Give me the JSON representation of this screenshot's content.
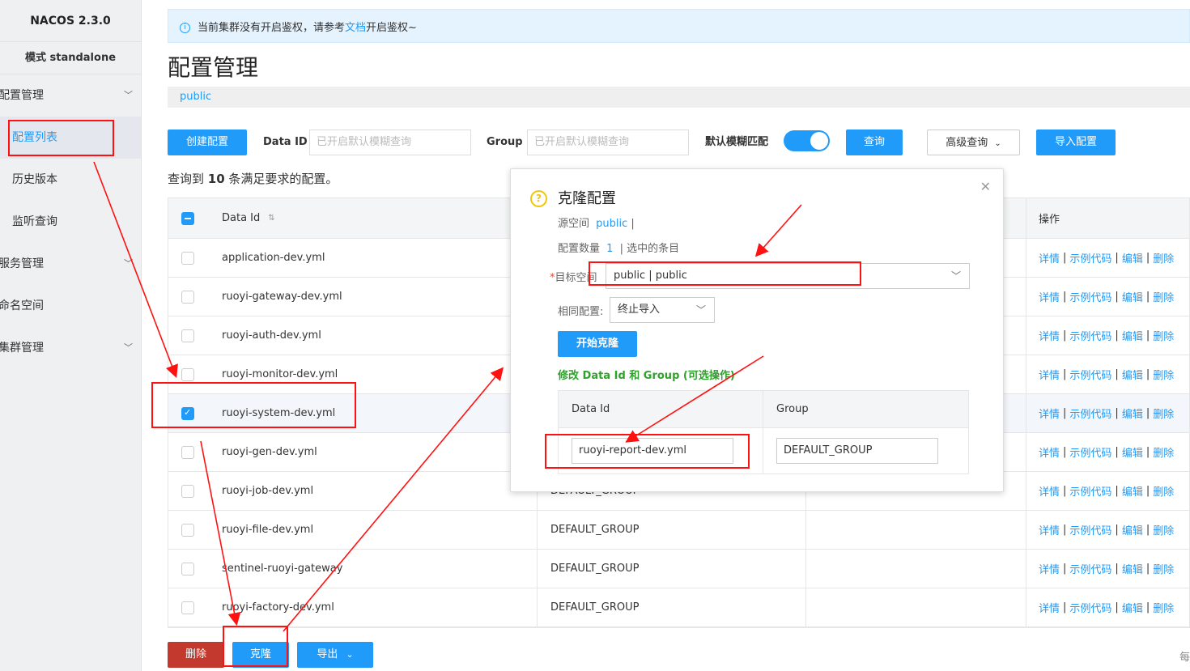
{
  "sidebar": {
    "brand": "NACOS 2.3.0",
    "mode": "模式 standalone",
    "groups": [
      {
        "label": "配置管理"
      },
      {
        "label": "服务管理"
      },
      {
        "label": "命名空间"
      },
      {
        "label": "集群管理"
      }
    ],
    "items": [
      {
        "label": "配置列表"
      },
      {
        "label": "历史版本"
      },
      {
        "label": "监听查询"
      }
    ]
  },
  "notice": {
    "text_before": "当前集群没有开启鉴权，请参考",
    "link": "文档",
    "text_after": "开启鉴权~"
  },
  "page": {
    "title": "配置管理",
    "namespace": "public"
  },
  "toolbar": {
    "create_label": "创建配置",
    "dataid_label": "Data ID",
    "dataid_placeholder": "已开启默认模糊查询",
    "group_label": "Group",
    "group_placeholder": "已开启默认模糊查询",
    "fuzzy_label": "默认模糊匹配",
    "query_label": "查询",
    "advanced_label": "高级查询",
    "import_label": "导入配置"
  },
  "summary": {
    "prefix": "查询到 ",
    "count": "10",
    "suffix": " 条满足要求的配置。"
  },
  "table": {
    "col_dataid": "Data Id",
    "col_ops": "操作",
    "ops": {
      "detail": "详情",
      "sample": "示例代码",
      "edit": "编辑",
      "delete": "删除"
    },
    "rows": [
      {
        "dataid": "application-dev.yml",
        "group": ""
      },
      {
        "dataid": "ruoyi-gateway-dev.yml",
        "group": ""
      },
      {
        "dataid": "ruoyi-auth-dev.yml",
        "group": ""
      },
      {
        "dataid": "ruoyi-monitor-dev.yml",
        "group": ""
      },
      {
        "dataid": "ruoyi-system-dev.yml",
        "group": ""
      },
      {
        "dataid": "ruoyi-gen-dev.yml",
        "group": ""
      },
      {
        "dataid": "ruoyi-job-dev.yml",
        "group": "DEFAULT_GROUP"
      },
      {
        "dataid": "ruoyi-file-dev.yml",
        "group": "DEFAULT_GROUP"
      },
      {
        "dataid": "sentinel-ruoyi-gateway",
        "group": "DEFAULT_GROUP"
      },
      {
        "dataid": "ruoyi-factory-dev.yml",
        "group": "DEFAULT_GROUP"
      }
    ]
  },
  "bottom": {
    "delete_label": "删除",
    "clone_label": "克隆",
    "export_label": "导出",
    "per_page": "每"
  },
  "dialog": {
    "title": "克隆配置",
    "source_label": "源空间",
    "source_value": "public",
    "source_sep": "|",
    "count_label": "配置数量",
    "count_value": "1",
    "count_suffix": "| 选中的条目",
    "target_label": "目标空间",
    "target_value": "public | public",
    "same_label": "相同配置:",
    "same_value": "终止导入",
    "start_label": "开始克隆",
    "modify_title": "修改 Data Id 和 Group (可选操作)",
    "col_dataid": "Data Id",
    "col_group": "Group",
    "new_dataid": "ruoyi-report-dev.yml",
    "new_group": "DEFAULT_GROUP"
  }
}
